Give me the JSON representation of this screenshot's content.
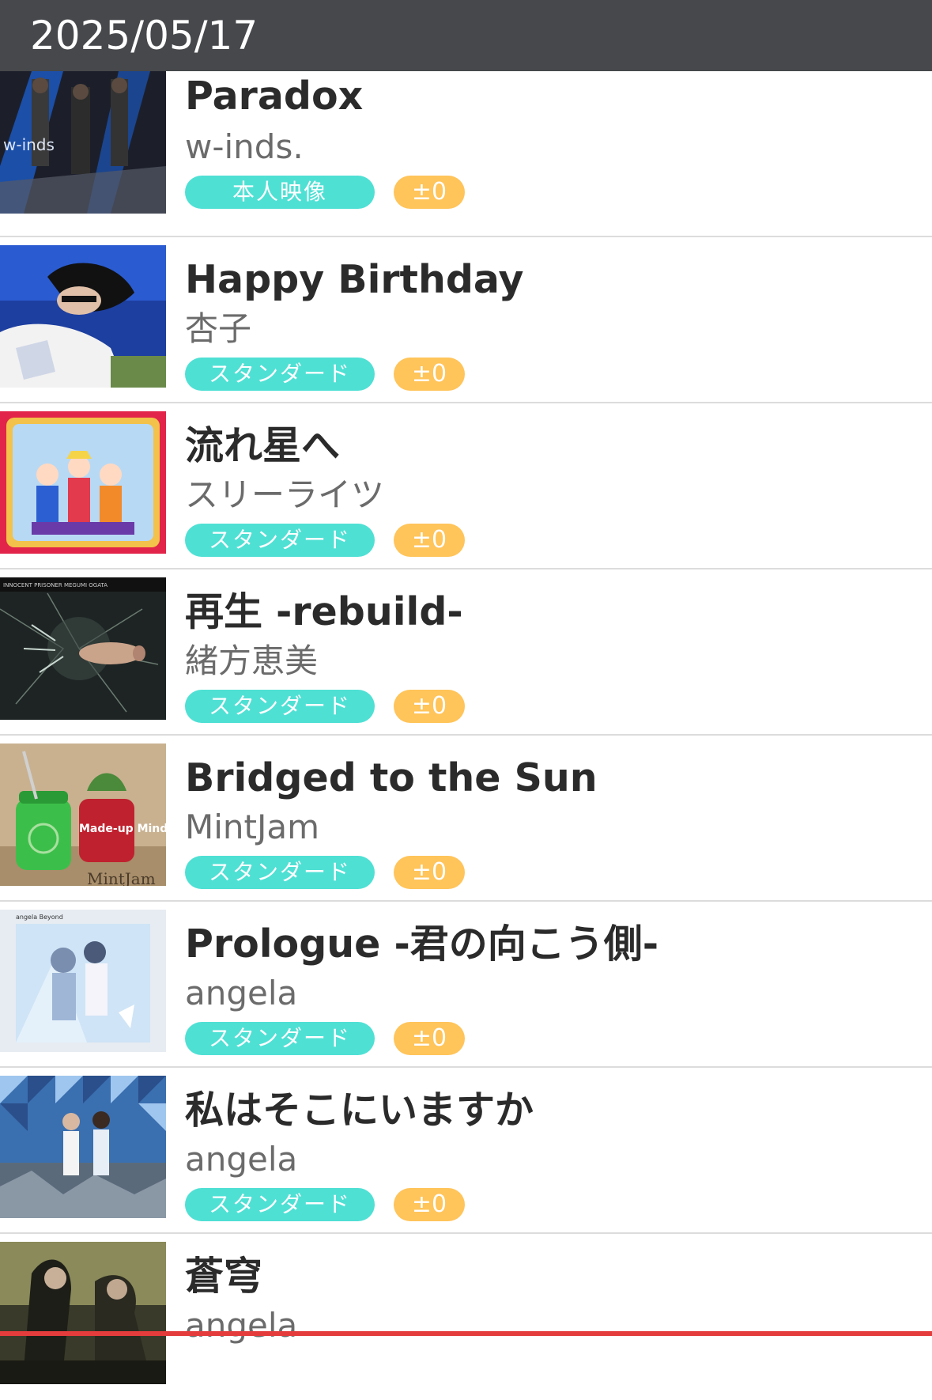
{
  "header": {
    "date": "2025/05/17"
  },
  "songs": [
    {
      "title": "Paradox",
      "artist": "w-inds.",
      "kind": "本人映像",
      "change": "±0",
      "thumb_icon": "album-art-w-inds"
    },
    {
      "title": "Happy Birthday",
      "artist": "杏子",
      "kind": "スタンダード",
      "change": "±0",
      "thumb_icon": "album-art-anzu"
    },
    {
      "title": "流れ星へ",
      "artist": "スリーライツ",
      "kind": "スタンダード",
      "change": "±0",
      "thumb_icon": "album-art-sailor-moon"
    },
    {
      "title": "再生 -rebuild-",
      "artist": "緒方恵美",
      "kind": "スタンダード",
      "change": "±0",
      "thumb_icon": "album-art-innocent-prisoner"
    },
    {
      "title": "Bridged to the Sun",
      "artist": "MintJam",
      "kind": "スタンダード",
      "change": "±0",
      "thumb_icon": "album-art-mintjam"
    },
    {
      "title": "Prologue -君の向こう側-",
      "artist": "angela",
      "kind": "スタンダード",
      "change": "±0",
      "thumb_icon": "album-art-angela-1"
    },
    {
      "title": "私はそこにいますか",
      "artist": "angela",
      "kind": "スタンダード",
      "change": "±0",
      "thumb_icon": "album-art-angela-2"
    },
    {
      "title": "蒼穹",
      "artist": "angela",
      "thumb_icon": "album-art-angela-3"
    }
  ],
  "album_art_text": {
    "w_inds": "w-inds",
    "innocent_prisoner": "INNOCENT PRISONER  MEGUMI OGATA",
    "mintjam_name": "MintJam",
    "mintjam_album": "Made-up Mind",
    "angela": "angela Beyond"
  },
  "colors": {
    "header_bg": "#46484b",
    "kind_badge": "#4fe0d4",
    "change_badge": "#ffc45a",
    "accent_bottom": "#e43c3c"
  }
}
